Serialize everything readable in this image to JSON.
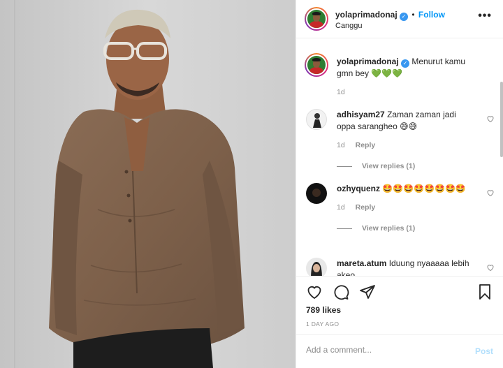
{
  "post": {
    "username": "yolaprimadonaj",
    "follow_label": "Follow",
    "location": "Canggu",
    "more_label": "•••"
  },
  "caption": {
    "username": "yolaprimadonaj",
    "text": "Menurut kamu gmn bey",
    "emojis": "💚💚💚",
    "time": "1d"
  },
  "comments": [
    {
      "username": "adhisyam27",
      "text": "Zaman zaman jadi oppa sarangheo",
      "emojis": "😅😅",
      "time": "1d",
      "reply_label": "Reply",
      "view_replies": "View replies (1)"
    },
    {
      "username": "ozhyquenz",
      "text": "",
      "emojis": "🤩🤩🤩🤩🤩🤩🤩🤩",
      "time": "1d",
      "reply_label": "Reply",
      "view_replies": "View replies (1)"
    },
    {
      "username": "mareta.atum",
      "text": "Iduung nyaaaaa lebih akeo",
      "emojis": ""
    }
  ],
  "actions": {
    "likes": "789 likes",
    "date": "1 DAY AGO"
  },
  "add_comment": {
    "placeholder": "Add a comment...",
    "post_label": "Post"
  },
  "colors": {
    "accent": "#0095f6",
    "post_disabled": "#b2dffc",
    "muted": "#8e8e8e"
  }
}
